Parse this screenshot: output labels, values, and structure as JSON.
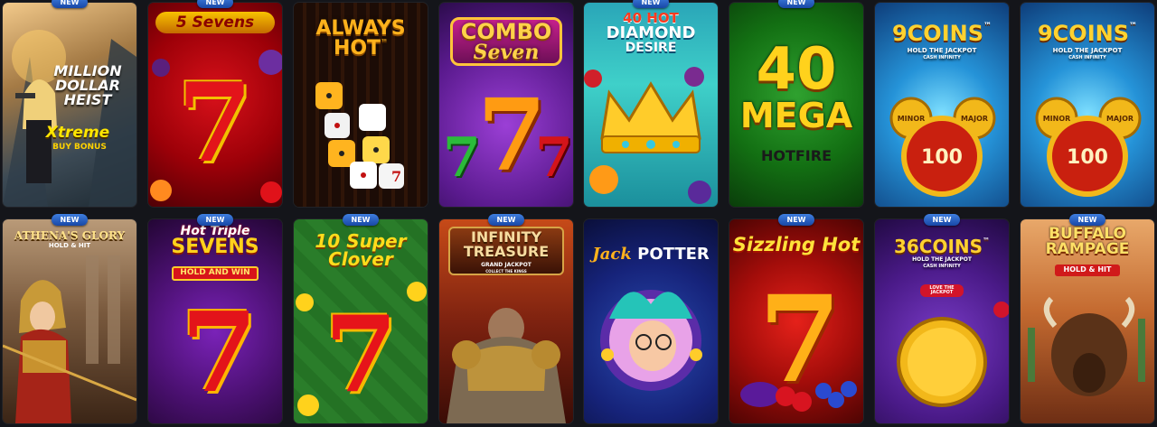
{
  "badge_label": "NEW",
  "games": [
    {
      "id": "mdh",
      "title_line1": "MILLION",
      "title_line2": "DOLLAR",
      "title_line3": "HEIST",
      "sub": "Xtreme",
      "sub2": "BUY BONUS",
      "new": true
    },
    {
      "id": "5s",
      "title_line1": "5 Sevens",
      "new": true
    },
    {
      "id": "ah",
      "title_line1": "ALWAYS",
      "title_line2": "HOT",
      "mark": "™",
      "new": false
    },
    {
      "id": "cs",
      "title_line1": "COMBO",
      "title_line2": "Seven",
      "new": false
    },
    {
      "id": "40hdd",
      "title_line1": "40 HOT",
      "title_line2": "DIAMOND",
      "title_line3": "DESIRE",
      "new": true
    },
    {
      "id": "40mh",
      "title_line1": "40",
      "title_line2": "MEGA",
      "title_line3": "HOTFIRE",
      "new": true
    },
    {
      "id": "9c1",
      "title_line1": "9COINS",
      "mark": "™",
      "sub": "HOLD THE JACKPOT",
      "sub2": "CASH INFINITY",
      "minor": "MINOR",
      "major": "MAJOR",
      "value": "100",
      "new": false
    },
    {
      "id": "9c2",
      "title_line1": "9COINS",
      "mark": "™",
      "sub": "HOLD THE JACKPOT",
      "sub2": "CASH INFINITY",
      "minor": "MINOR",
      "major": "MAJOR",
      "value": "100",
      "new": false
    },
    {
      "id": "ag",
      "title_line1": "ATHENA'S GLORY",
      "title_line2": "HOLD & HIT",
      "new": true
    },
    {
      "id": "hts",
      "title_line1": "Hot Triple",
      "title_line2": "SEVENS",
      "title_line3": "HOLD AND WIN",
      "new": true
    },
    {
      "id": "10sc",
      "title_line1": "10 Super",
      "title_line2": "Clover",
      "new": true
    },
    {
      "id": "it",
      "title_line1": "INFINITY",
      "title_line2": "TREASURE",
      "title_line3": "GRAND JACKPOT",
      "sub": "COLLECT THE KINGS",
      "new": true
    },
    {
      "id": "jp",
      "title_line1": "Jack",
      "title_line2": "POTTER",
      "new": false
    },
    {
      "id": "sh",
      "title_line1": "Sizzling Hot",
      "new": true
    },
    {
      "id": "36c",
      "title_line1": "36COINS",
      "mark": "™",
      "sub": "HOLD THE JACKPOT",
      "sub2": "CASH INFINITY",
      "sub3": "LOVE THE JACKPOT",
      "new": true
    },
    {
      "id": "br",
      "title_line1": "BUFFALO",
      "title_line2": "RAMPAGE",
      "title_line3": "HOLD & HIT",
      "new": true
    }
  ]
}
